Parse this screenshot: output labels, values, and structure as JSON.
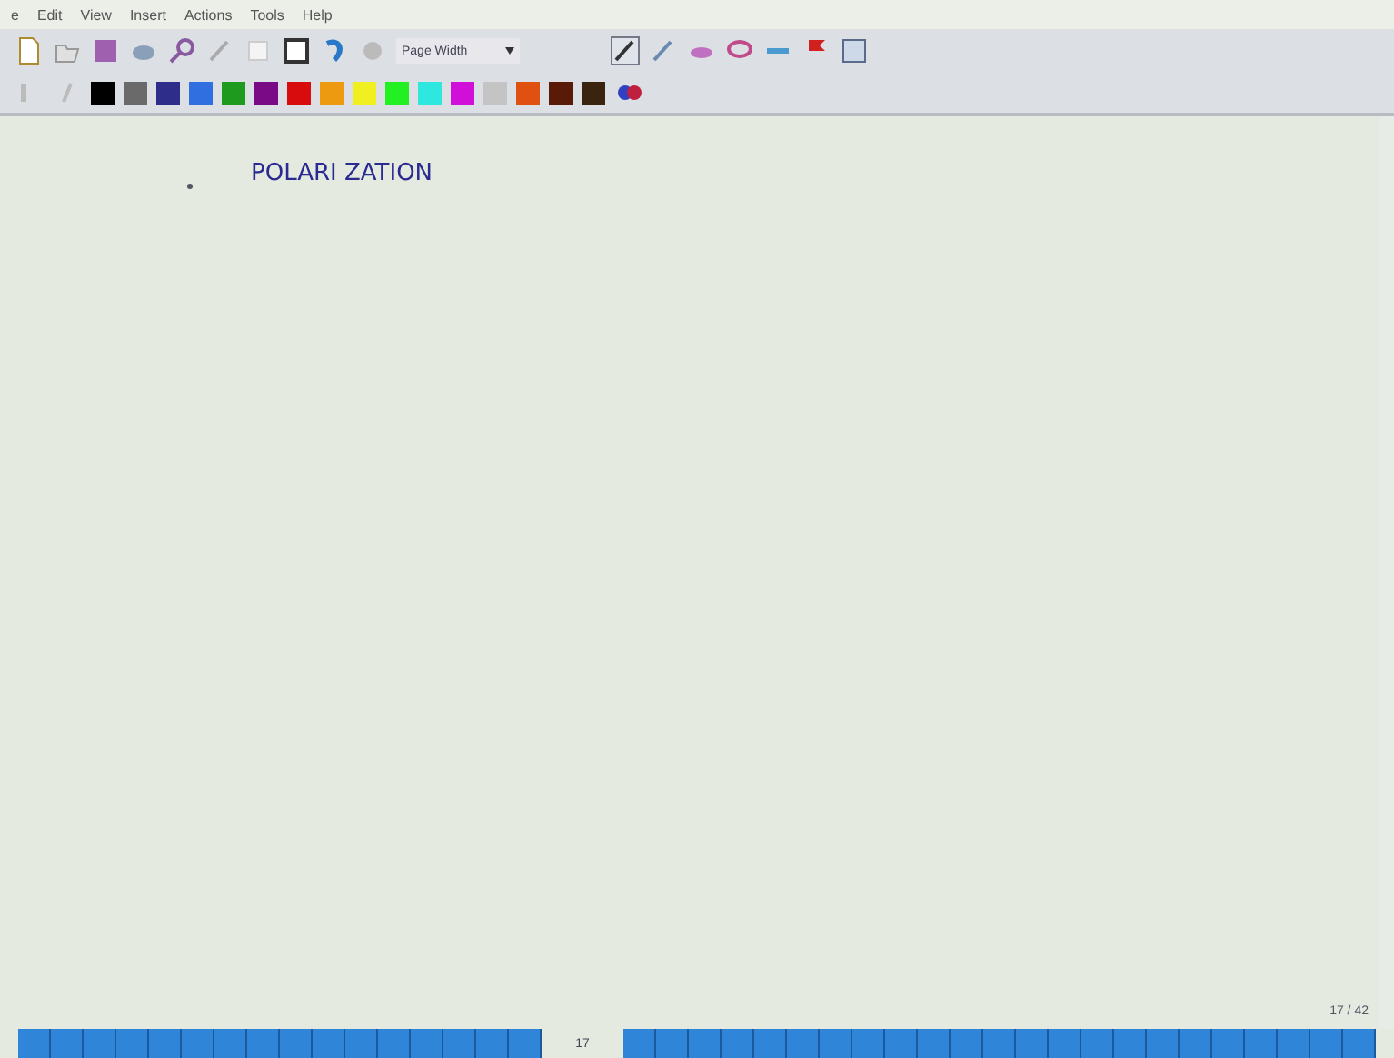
{
  "menu": [
    "e",
    "Edit",
    "View",
    "Insert",
    "Actions",
    "Tools",
    "Help"
  ],
  "zoom": {
    "value": "Page Width"
  },
  "pen_colors": [
    {
      "color": "#000000"
    },
    {
      "color": "#6a6a6a"
    },
    {
      "color": "#2e2e8a"
    },
    {
      "color": "#2f6fe0"
    },
    {
      "color": "#1e9a1e"
    },
    {
      "color": "#7a0a86"
    },
    {
      "color": "#d80c0c"
    },
    {
      "color": "#ee9a10"
    },
    {
      "color": "#f0f020"
    },
    {
      "color": "#22f022"
    },
    {
      "color": "#2ee8e0"
    },
    {
      "color": "#d010d8"
    },
    {
      "color": "#c4c4c4"
    },
    {
      "color": "#e05010"
    },
    {
      "color": "#5a1a08"
    },
    {
      "color": "#3a2410"
    }
  ],
  "note": {
    "heading": "POLARI ZATION"
  },
  "page_counter": "17 / 42",
  "page_strip": {
    "current": "17"
  }
}
